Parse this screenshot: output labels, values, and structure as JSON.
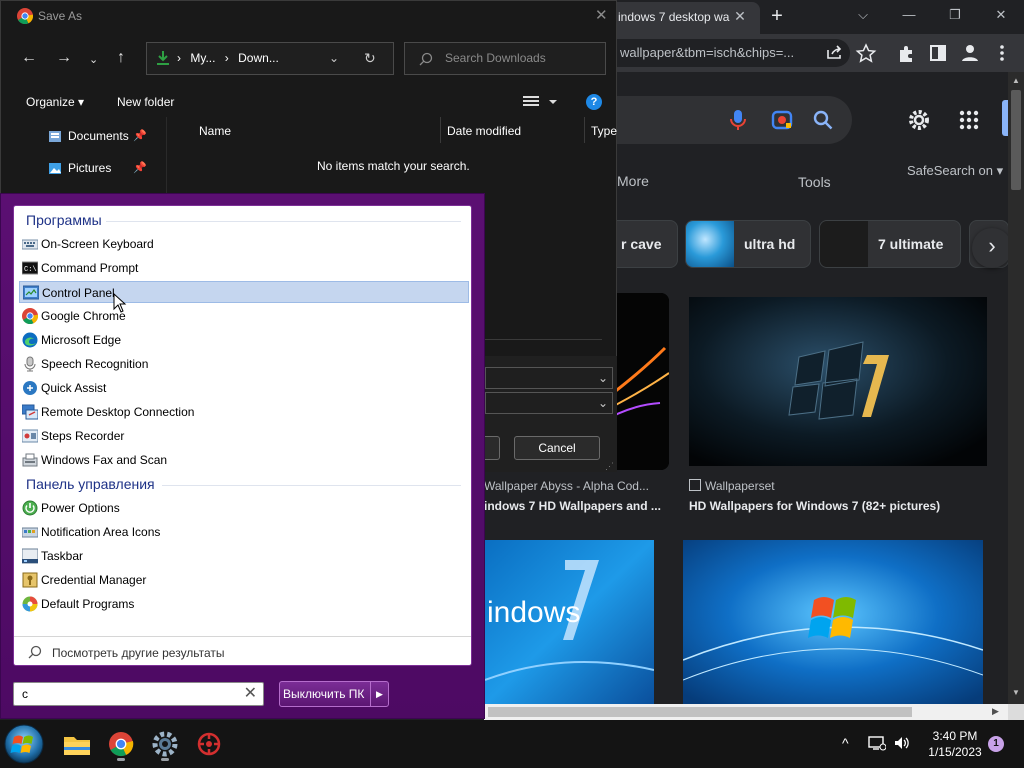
{
  "chrome": {
    "tab_title": "indows 7 desktop wa",
    "omnibox_text": "wallpaper&tbm=isch&chips=...",
    "google": {
      "nav_more": "More",
      "nav_tools": "Tools",
      "safesearch": "SafeSearch on",
      "chips": [
        "r cave",
        "ultra hd",
        "7 ultimate"
      ],
      "results": [
        {
          "source": "Wallpaper Abyss - Alpha Cod...",
          "title": "indows 7 HD Wallpapers and ..."
        },
        {
          "source": "Wallpaperset",
          "title": "HD Wallpapers for Windows 7 (82+ pictures)"
        }
      ],
      "image_text": "indows"
    }
  },
  "save_dialog": {
    "title": "Save As",
    "address": [
      "My...",
      "Down..."
    ],
    "search_placeholder": "Search Downloads",
    "organize": "Organize",
    "new_folder": "New folder",
    "sidebar": [
      "Documents",
      "Pictures"
    ],
    "columns": [
      "Name",
      "Date modified",
      "Type"
    ],
    "empty_message": "No items match your search.",
    "cancel": "Cancel"
  },
  "start_menu": {
    "group_programs": "Программы",
    "programs": [
      "On-Screen Keyboard",
      "Command Prompt",
      "Control Panel",
      "Google Chrome",
      "Microsoft Edge",
      "Speech Recognition",
      "Quick Assist",
      "Remote Desktop Connection",
      "Steps Recorder",
      "Windows Fax and Scan"
    ],
    "group_control_panel": "Панель управления",
    "control_panel_items": [
      "Power Options",
      "Notification Area Icons",
      "Taskbar",
      "Credential Manager",
      "Default Programs"
    ],
    "more_results": "Посмотреть другие результаты",
    "search_value": "c",
    "shutdown": "Выключить ПК",
    "highlight_color": "#c5d6ef"
  },
  "taskbar": {
    "time": "3:40 PM",
    "date": "1/15/2023",
    "notification_count": "1"
  }
}
